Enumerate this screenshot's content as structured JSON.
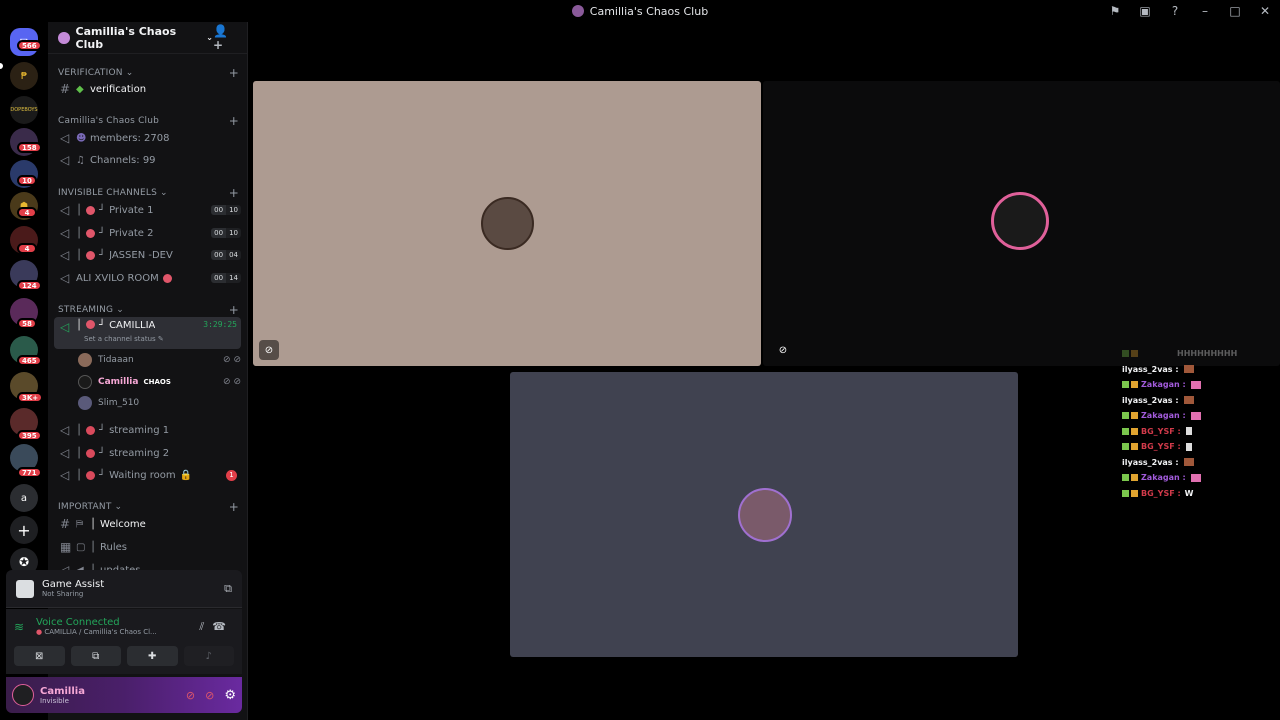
{
  "window": {
    "title": "Camillia's Chaos Club"
  },
  "guilds": [
    {
      "name": "discord-home",
      "badge": "566"
    },
    {
      "name": "guild-2",
      "badge": ""
    },
    {
      "name": "guild-dopeboys",
      "label": "DOPEBOYS",
      "badge": ""
    },
    {
      "name": "guild-4",
      "badge": "158"
    },
    {
      "name": "guild-5",
      "badge": "10"
    },
    {
      "name": "guild-6",
      "badge": "4"
    },
    {
      "name": "guild-7",
      "badge": "4"
    },
    {
      "name": "guild-8",
      "badge": "124"
    },
    {
      "name": "guild-9",
      "badge": "58"
    },
    {
      "name": "guild-10",
      "badge": "465"
    },
    {
      "name": "guild-11",
      "badge": "3K+"
    },
    {
      "name": "guild-12",
      "badge": "395"
    },
    {
      "name": "guild-13",
      "badge": "771"
    },
    {
      "name": "guild-a",
      "label": "a",
      "badge": ""
    }
  ],
  "server": {
    "name": "Camillia's Chaos Club",
    "categories": {
      "verification": "VERIFICATION",
      "club": "Camillia's Chaos Club",
      "invisible": "INVISIBLE CHANNELS",
      "streaming": "STREAMING",
      "important": "IMPORTANT"
    },
    "channels": {
      "verification": "verification",
      "members": "members: 2708",
      "channels_count": "Channels: 99",
      "private1": "Private 1",
      "private2": "Private 2",
      "jassen": "JASSEN -DEV",
      "ali": "ALI XVILO ROOM",
      "camillia": "CAMILLIA",
      "camillia_timer": "3:29:25",
      "channel_status": "Set a channel status",
      "streaming1": "streaming 1",
      "streaming2": "streaming 2",
      "waiting": "Waiting room",
      "waiting_badge": "1",
      "welcome": "Welcome",
      "rules": "Rules",
      "updates": "updates"
    },
    "counts": {
      "private1": [
        "00",
        "10"
      ],
      "private2": [
        "00",
        "10"
      ],
      "jassen": [
        "00",
        "04"
      ],
      "ali": [
        "00",
        "14"
      ]
    },
    "voice_users": [
      "Tidaaan",
      "Camillia",
      "Slim_510"
    ],
    "voice_user_tag": "CHAOS"
  },
  "game_assist": {
    "title": "Game Assist",
    "status": "Not Sharing"
  },
  "voice": {
    "status": "Voice Connected",
    "channel": "CAMILLIA / Camillia's Chaos Cl..."
  },
  "user": {
    "name": "Camillia",
    "status": "Invisible"
  },
  "chat": [
    {
      "name": "",
      "msg": "HHHHHHHHH",
      "color": "#e0566a",
      "badges": true,
      "dim": true
    },
    {
      "name": "ilyass_2vas :",
      "msg": "",
      "color": "#f2f3f5",
      "badges": false,
      "emote": true
    },
    {
      "name": "Zakagan :",
      "msg": "",
      "color": "#a25bdb",
      "badges": true,
      "emote": true
    },
    {
      "name": "ilyass_2vas :",
      "msg": "",
      "color": "#f2f3f5",
      "badges": false,
      "emote": true
    },
    {
      "name": "Zakagan :",
      "msg": "",
      "color": "#a25bdb",
      "badges": true,
      "emote": true
    },
    {
      "name": "BG_YSF :",
      "msg": "",
      "color": "#d13a4a",
      "badges": true,
      "emote": true
    },
    {
      "name": "BG_YSF :",
      "msg": "",
      "color": "#d13a4a",
      "badges": true,
      "emote": true
    },
    {
      "name": "ilyass_2vas :",
      "msg": "",
      "color": "#f2f3f5",
      "badges": false,
      "emote": true
    },
    {
      "name": "Zakagan :",
      "msg": "",
      "color": "#a25bdb",
      "badges": true,
      "emote": true
    },
    {
      "name": "BG_YSF :",
      "msg": "W",
      "color": "#d13a4a",
      "badges": true,
      "emote": false
    }
  ],
  "colors": {
    "accent": "#23a55a",
    "danger": "#e23f49",
    "tile1": "#ad9b91",
    "tile2": "#0b0b0c",
    "tile3": "#404250"
  }
}
